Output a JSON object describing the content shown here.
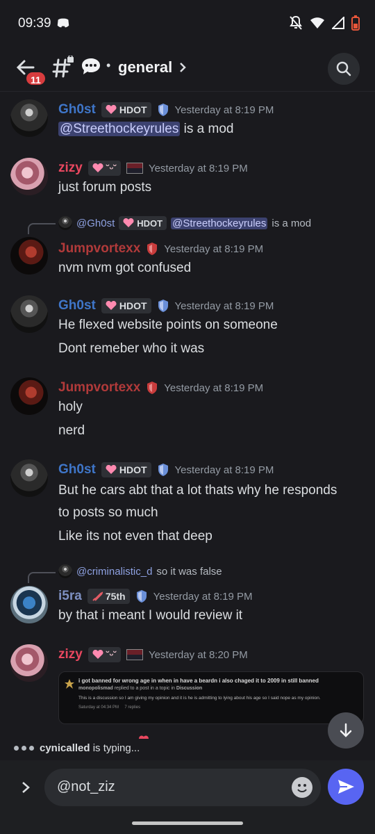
{
  "status_bar": {
    "time": "09:39"
  },
  "header": {
    "unread_badge": "11",
    "channel_separator": "•",
    "channel_name": "general"
  },
  "messages": [
    {
      "user": "Gh0st",
      "tag": "HDOT",
      "time": "Yesterday at 8:19 PM",
      "lines": [
        {
          "mention": "@Streethockeyrules",
          "text": " is a mod"
        }
      ]
    },
    {
      "user": "zizy",
      "emote": "˘ᵕ˘",
      "time": "Yesterday at 8:19 PM",
      "lines": [
        {
          "text": "just forum posts"
        }
      ]
    },
    {
      "reply": {
        "name": "@Gh0st",
        "tag": "HDOT",
        "mention": "@Streethockeyrules",
        "text": " is a mod"
      },
      "user": "Jumpvortexx",
      "time": "Yesterday at 8:19 PM",
      "lines": [
        {
          "text": "nvm nvm got confused"
        }
      ]
    },
    {
      "user": "Gh0st",
      "tag": "HDOT",
      "time": "Yesterday at 8:19 PM",
      "lines": [
        {
          "text": "He flexed website points on someone"
        },
        {
          "text": "Dont remeber who it was"
        }
      ]
    },
    {
      "user": "Jumpvortexx",
      "time": "Yesterday at 8:19 PM",
      "lines": [
        {
          "text": "holy"
        },
        {
          "text": "nerd"
        }
      ]
    },
    {
      "user": "Gh0st",
      "tag": "HDOT",
      "time": "Yesterday at 8:19 PM",
      "lines": [
        {
          "text": "But he cars abt that a lot thats why he responds"
        },
        {
          "text": "to posts so much"
        },
        {
          "text": "Like its not even that deep"
        }
      ]
    },
    {
      "reply": {
        "name": "@criminalistic_d",
        "text": "so it was false"
      },
      "user": "i5ra",
      "tag": "75th",
      "time": "Yesterday at 8:19 PM",
      "lines": [
        {
          "text": "by that i meant I would review it"
        }
      ]
    },
    {
      "user": "zizy",
      "emote": "˘ᵕ˘",
      "time": "Yesterday at 8:20 PM"
    }
  ],
  "embed": {
    "title": "i got banned for wrong age in when in have a beardn i also chaged it to 2009 in still banned",
    "author": "monopolismad",
    "author_suffix": " replied to a post in a topic in ",
    "topic": "Discussion",
    "body": "This is a discussion so I am giving my opinion and it is he is admitting to lying about his age so I said nope as my opinion.",
    "meta_time": "Saturday at 04:34 PM",
    "meta_replies": "7 replies"
  },
  "typing": {
    "user": "cynicalled",
    "suffix": " is typing..."
  },
  "composer": {
    "value": "@not_ziz"
  },
  "colors": {
    "accent": "#5865f2",
    "ghost": "#3f76c9",
    "zizy": "#e8475f",
    "jump": "#b13a3a",
    "i5ra": "#7d8fc0",
    "badge": "#d83c3e"
  }
}
